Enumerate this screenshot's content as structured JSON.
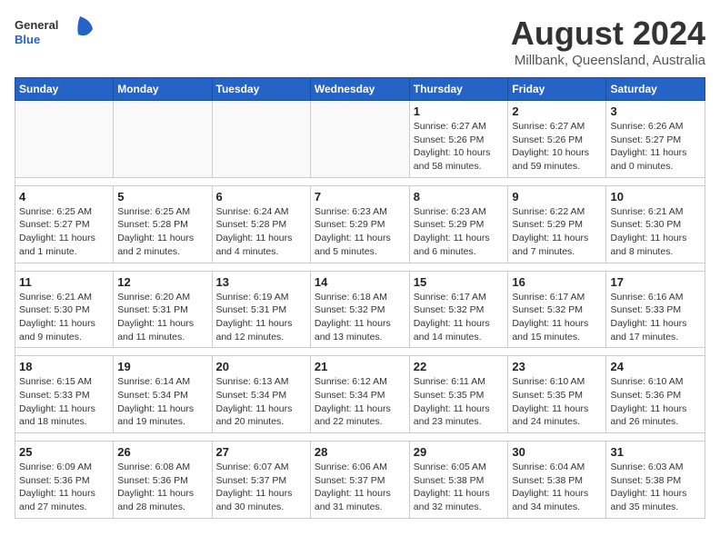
{
  "header": {
    "logo": {
      "general": "General",
      "blue": "Blue"
    },
    "title": "August 2024",
    "location": "Millbank, Queensland, Australia"
  },
  "weekdays": [
    "Sunday",
    "Monday",
    "Tuesday",
    "Wednesday",
    "Thursday",
    "Friday",
    "Saturday"
  ],
  "weeks": [
    [
      {
        "day": "",
        "info": ""
      },
      {
        "day": "",
        "info": ""
      },
      {
        "day": "",
        "info": ""
      },
      {
        "day": "",
        "info": ""
      },
      {
        "day": "1",
        "info": "Sunrise: 6:27 AM\nSunset: 5:26 PM\nDaylight: 10 hours\nand 58 minutes."
      },
      {
        "day": "2",
        "info": "Sunrise: 6:27 AM\nSunset: 5:26 PM\nDaylight: 10 hours\nand 59 minutes."
      },
      {
        "day": "3",
        "info": "Sunrise: 6:26 AM\nSunset: 5:27 PM\nDaylight: 11 hours\nand 0 minutes."
      }
    ],
    [
      {
        "day": "4",
        "info": "Sunrise: 6:25 AM\nSunset: 5:27 PM\nDaylight: 11 hours\nand 1 minute."
      },
      {
        "day": "5",
        "info": "Sunrise: 6:25 AM\nSunset: 5:28 PM\nDaylight: 11 hours\nand 2 minutes."
      },
      {
        "day": "6",
        "info": "Sunrise: 6:24 AM\nSunset: 5:28 PM\nDaylight: 11 hours\nand 4 minutes."
      },
      {
        "day": "7",
        "info": "Sunrise: 6:23 AM\nSunset: 5:29 PM\nDaylight: 11 hours\nand 5 minutes."
      },
      {
        "day": "8",
        "info": "Sunrise: 6:23 AM\nSunset: 5:29 PM\nDaylight: 11 hours\nand 6 minutes."
      },
      {
        "day": "9",
        "info": "Sunrise: 6:22 AM\nSunset: 5:29 PM\nDaylight: 11 hours\nand 7 minutes."
      },
      {
        "day": "10",
        "info": "Sunrise: 6:21 AM\nSunset: 5:30 PM\nDaylight: 11 hours\nand 8 minutes."
      }
    ],
    [
      {
        "day": "11",
        "info": "Sunrise: 6:21 AM\nSunset: 5:30 PM\nDaylight: 11 hours\nand 9 minutes."
      },
      {
        "day": "12",
        "info": "Sunrise: 6:20 AM\nSunset: 5:31 PM\nDaylight: 11 hours\nand 11 minutes."
      },
      {
        "day": "13",
        "info": "Sunrise: 6:19 AM\nSunset: 5:31 PM\nDaylight: 11 hours\nand 12 minutes."
      },
      {
        "day": "14",
        "info": "Sunrise: 6:18 AM\nSunset: 5:32 PM\nDaylight: 11 hours\nand 13 minutes."
      },
      {
        "day": "15",
        "info": "Sunrise: 6:17 AM\nSunset: 5:32 PM\nDaylight: 11 hours\nand 14 minutes."
      },
      {
        "day": "16",
        "info": "Sunrise: 6:17 AM\nSunset: 5:32 PM\nDaylight: 11 hours\nand 15 minutes."
      },
      {
        "day": "17",
        "info": "Sunrise: 6:16 AM\nSunset: 5:33 PM\nDaylight: 11 hours\nand 17 minutes."
      }
    ],
    [
      {
        "day": "18",
        "info": "Sunrise: 6:15 AM\nSunset: 5:33 PM\nDaylight: 11 hours\nand 18 minutes."
      },
      {
        "day": "19",
        "info": "Sunrise: 6:14 AM\nSunset: 5:34 PM\nDaylight: 11 hours\nand 19 minutes."
      },
      {
        "day": "20",
        "info": "Sunrise: 6:13 AM\nSunset: 5:34 PM\nDaylight: 11 hours\nand 20 minutes."
      },
      {
        "day": "21",
        "info": "Sunrise: 6:12 AM\nSunset: 5:34 PM\nDaylight: 11 hours\nand 22 minutes."
      },
      {
        "day": "22",
        "info": "Sunrise: 6:11 AM\nSunset: 5:35 PM\nDaylight: 11 hours\nand 23 minutes."
      },
      {
        "day": "23",
        "info": "Sunrise: 6:10 AM\nSunset: 5:35 PM\nDaylight: 11 hours\nand 24 minutes."
      },
      {
        "day": "24",
        "info": "Sunrise: 6:10 AM\nSunset: 5:36 PM\nDaylight: 11 hours\nand 26 minutes."
      }
    ],
    [
      {
        "day": "25",
        "info": "Sunrise: 6:09 AM\nSunset: 5:36 PM\nDaylight: 11 hours\nand 27 minutes."
      },
      {
        "day": "26",
        "info": "Sunrise: 6:08 AM\nSunset: 5:36 PM\nDaylight: 11 hours\nand 28 minutes."
      },
      {
        "day": "27",
        "info": "Sunrise: 6:07 AM\nSunset: 5:37 PM\nDaylight: 11 hours\nand 30 minutes."
      },
      {
        "day": "28",
        "info": "Sunrise: 6:06 AM\nSunset: 5:37 PM\nDaylight: 11 hours\nand 31 minutes."
      },
      {
        "day": "29",
        "info": "Sunrise: 6:05 AM\nSunset: 5:38 PM\nDaylight: 11 hours\nand 32 minutes."
      },
      {
        "day": "30",
        "info": "Sunrise: 6:04 AM\nSunset: 5:38 PM\nDaylight: 11 hours\nand 34 minutes."
      },
      {
        "day": "31",
        "info": "Sunrise: 6:03 AM\nSunset: 5:38 PM\nDaylight: 11 hours\nand 35 minutes."
      }
    ]
  ]
}
